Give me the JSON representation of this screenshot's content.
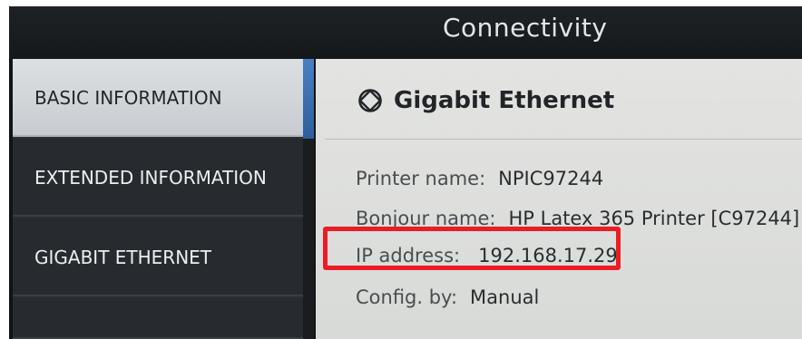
{
  "header": {
    "title": "Connectivity"
  },
  "sidebar": {
    "items": [
      {
        "label": "BASIC INFORMATION",
        "active": true
      },
      {
        "label": "EXTENDED INFORMATION",
        "active": false
      },
      {
        "label": "GIGABIT ETHERNET",
        "active": false
      }
    ]
  },
  "main": {
    "section_icon": "globe-icon",
    "section_title": "Gigabit Ethernet",
    "fields": [
      {
        "label": "Printer name:",
        "value": "NPIC97244"
      },
      {
        "label": "Bonjour name:",
        "value": "HP Latex 365 Printer [C97244]"
      },
      {
        "label": "IP address:",
        "value": "192.168.17.29"
      },
      {
        "label": "Config. by:",
        "value": "Manual"
      }
    ]
  },
  "colors": {
    "highlight": "#ec1c24",
    "accent": "#3f78be"
  }
}
